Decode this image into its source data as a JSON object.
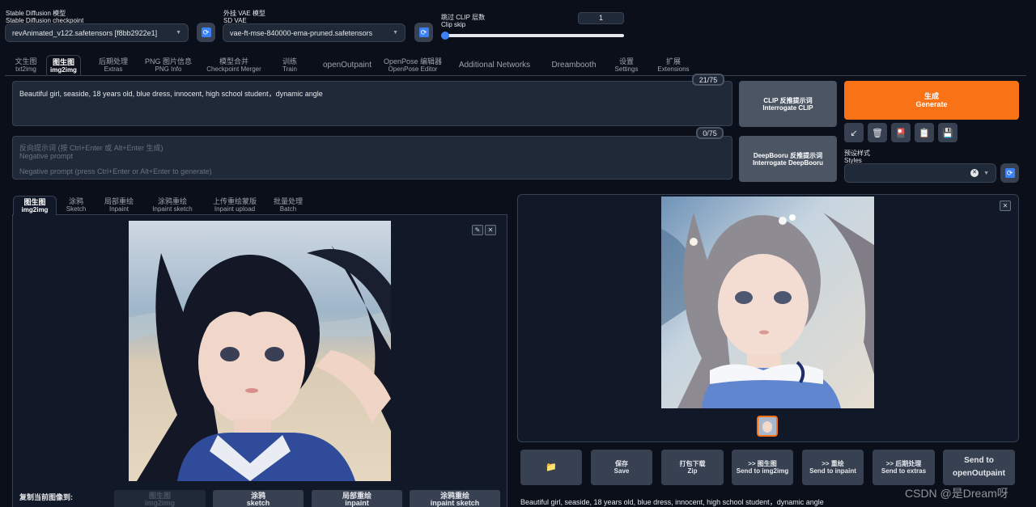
{
  "top": {
    "checkpoint_label_cn": "Stable Diffusion 模型",
    "checkpoint_label_en": "Stable Diffusion checkpoint",
    "checkpoint_value": "revAnimated_v122.safetensors [f8bb2922e1]",
    "vae_label_cn": "外挂 VAE 模型",
    "vae_label_en": "SD VAE",
    "vae_value": "vae-ft-mse-840000-ema-pruned.safetensors",
    "clip_label_cn": "跳过 CLIP 层数",
    "clip_label_en": "Clip skip",
    "clip_value": "1",
    "clip_fraction": 0.0
  },
  "tabs": [
    {
      "cn": "文生图",
      "en": "txt2img"
    },
    {
      "cn": "图生图",
      "en": "img2img"
    },
    {
      "cn": "后期处理",
      "en": "Extras"
    },
    {
      "cn": "PNG 图片信息",
      "en": "PNG Info"
    },
    {
      "cn": "模型合并",
      "en": "Checkpoint Merger"
    },
    {
      "cn": "训练",
      "en": "Train"
    },
    {
      "cn": "openOutpaint",
      "en": ""
    },
    {
      "cn": "OpenPose 编辑器",
      "en": "OpenPose Editor"
    },
    {
      "cn": "Additional Networks",
      "en": ""
    },
    {
      "cn": "Dreambooth",
      "en": ""
    },
    {
      "cn": "设置",
      "en": "Settings"
    },
    {
      "cn": "扩展",
      "en": "Extensions"
    }
  ],
  "prompt": {
    "text": "Beautiful girl, seaside, 18 years old, blue dress, innocent, high school student，dynamic angle",
    "counter": "21/75"
  },
  "negative": {
    "placeholder_cn": "反向提示词 (按 Ctrl+Enter 或 Alt+Enter 生成)",
    "placeholder_en": "Negative prompt",
    "placeholder_hint": "Negative prompt (press Ctrl+Enter or Alt+Enter to generate)",
    "counter": "0/75"
  },
  "interrogate": {
    "clip_line1": "CLIP    反推提示词",
    "clip_line2": "Interrogate CLIP",
    "deepbooru_line1": "DeepBooru 反推提示词",
    "deepbooru_line2": "Interrogate DeepBooru"
  },
  "generate": {
    "cn": "生成",
    "en": "Generate"
  },
  "styles": {
    "label_cn": "预设样式",
    "label_en": "Styles",
    "clear": "✕"
  },
  "tools": [
    {
      "icon": "↙",
      "name": "read-params-icon"
    },
    {
      "icon": "🗑",
      "name": "trash-icon"
    },
    {
      "icon": "🎴",
      "name": "extra-networks-icon"
    },
    {
      "icon": "📋",
      "name": "clipboard-icon"
    },
    {
      "icon": "💾",
      "name": "save-style-icon"
    }
  ],
  "subtabs": [
    {
      "cn": "图生图",
      "en": "img2img"
    },
    {
      "cn": "涂鸦",
      "en": "Sketch"
    },
    {
      "cn": "局部重绘",
      "en": "Inpaint"
    },
    {
      "cn": "涂鸦重绘",
      "en": "Inpaint sketch"
    },
    {
      "cn": "上传重绘蒙版",
      "en": "Inpaint upload"
    },
    {
      "cn": "批量处理",
      "en": "Batch"
    }
  ],
  "copy_to": {
    "label": "复制当前图像到:",
    "buttons": [
      {
        "cn": "图生图",
        "en": "img2img"
      },
      {
        "cn": "涂鸦",
        "en": "sketch"
      },
      {
        "cn": "局部重绘",
        "en": "inpaint"
      },
      {
        "cn": "涂鸦重绘",
        "en": "inpaint sketch"
      }
    ]
  },
  "output_buttons": [
    {
      "cn": "📁",
      "en": ""
    },
    {
      "cn": "保存",
      "en": "Save"
    },
    {
      "cn": "打包下载",
      "en": "Zip"
    },
    {
      "cn": ">> 图生图",
      "en": "Send to img2img"
    },
    {
      "cn": ">> 重绘",
      "en": "Send to inpaint"
    },
    {
      "cn": ">> 后期处理",
      "en": "Send to extras"
    },
    {
      "cn": "Send to",
      "en": "openOutpaint"
    }
  ],
  "output_caption": "Beautiful girl, seaside, 18 years old, blue dress, innocent, high school student，dynamic angle",
  "watermark": "CSDN @是Dream呀",
  "colors": {
    "accent": "#f97316",
    "bg": "#0b0f19",
    "panel": "#111827",
    "blue": "#3b82f6"
  }
}
